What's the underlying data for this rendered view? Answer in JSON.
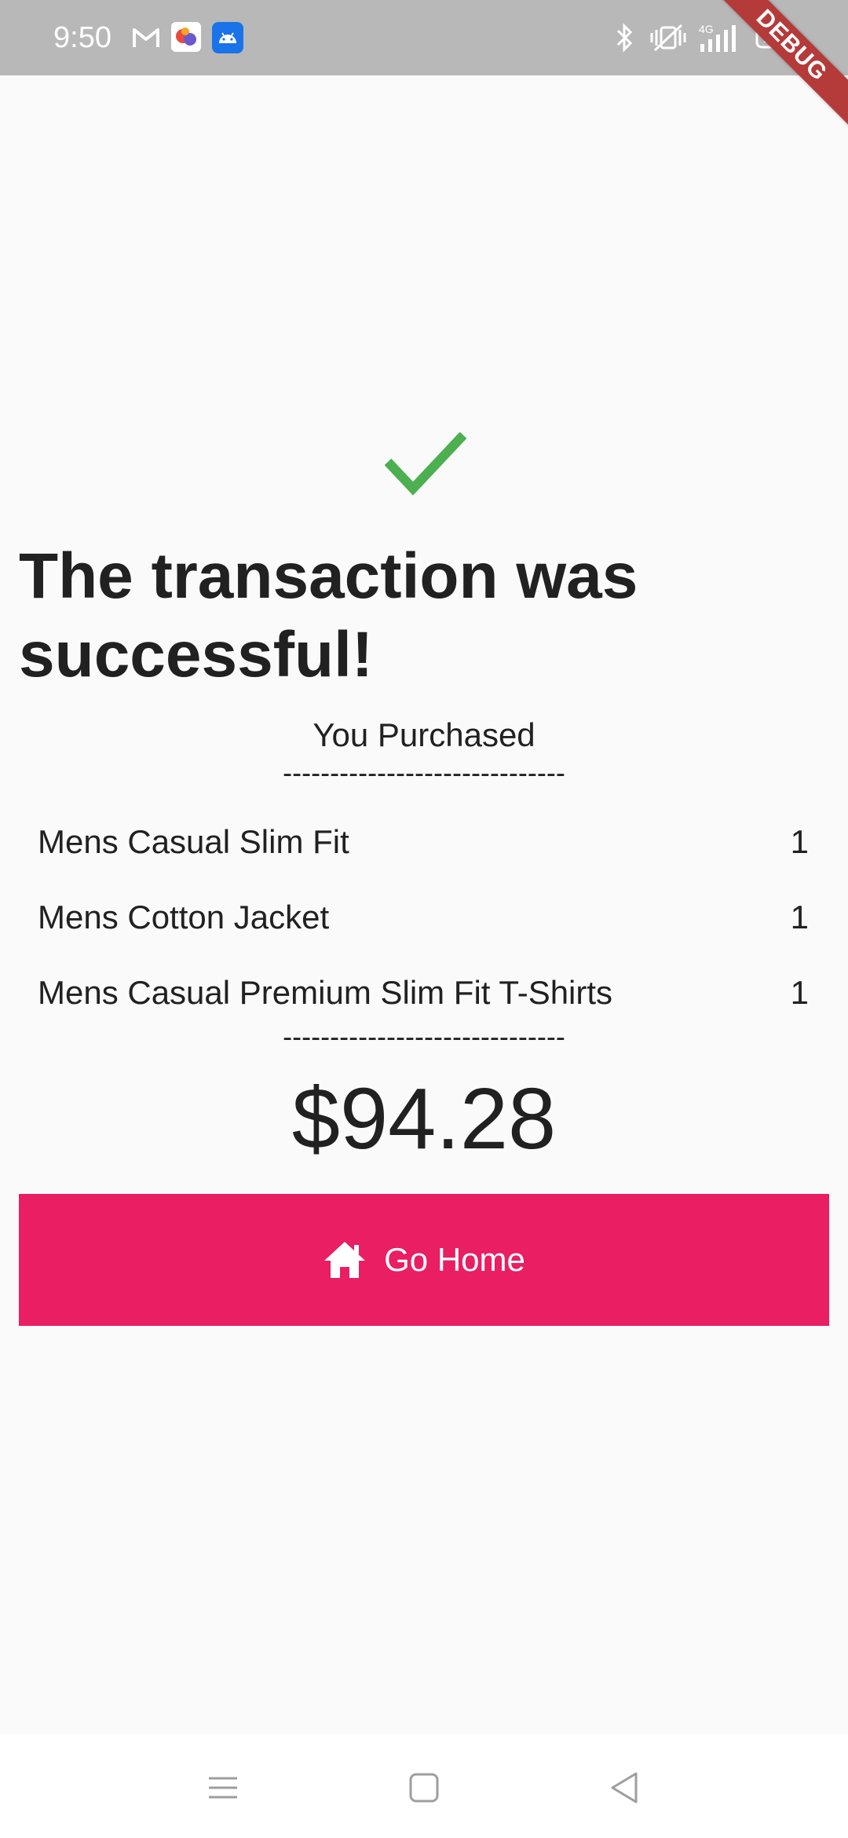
{
  "status_bar": {
    "time": "9:50",
    "icons": [
      "gmail-icon",
      "game-icon",
      "android-icon",
      "bluetooth-icon",
      "vibrate-icon",
      "network-4g-icon",
      "battery-icon"
    ],
    "battery_level": "100"
  },
  "debug_banner": {
    "label": "DEBUG"
  },
  "success": {
    "icon": "checkmark-icon",
    "icon_color": "#4caf50",
    "title": "The transaction was successful!"
  },
  "purchase": {
    "label": "You Purchased",
    "divider": "------------------------------",
    "items": [
      {
        "name": "Mens Casual Slim Fit",
        "qty": "1"
      },
      {
        "name": "Mens Cotton Jacket",
        "qty": "1"
      },
      {
        "name": "Mens Casual Premium Slim Fit T-Shirts",
        "qty": "1"
      }
    ],
    "total": "$94.28"
  },
  "home_button": {
    "label": "Go Home",
    "icon": "home-icon",
    "color": "#e91e63"
  },
  "nav_bar": {
    "buttons": [
      "menu-icon",
      "home-square-icon",
      "back-icon"
    ]
  }
}
